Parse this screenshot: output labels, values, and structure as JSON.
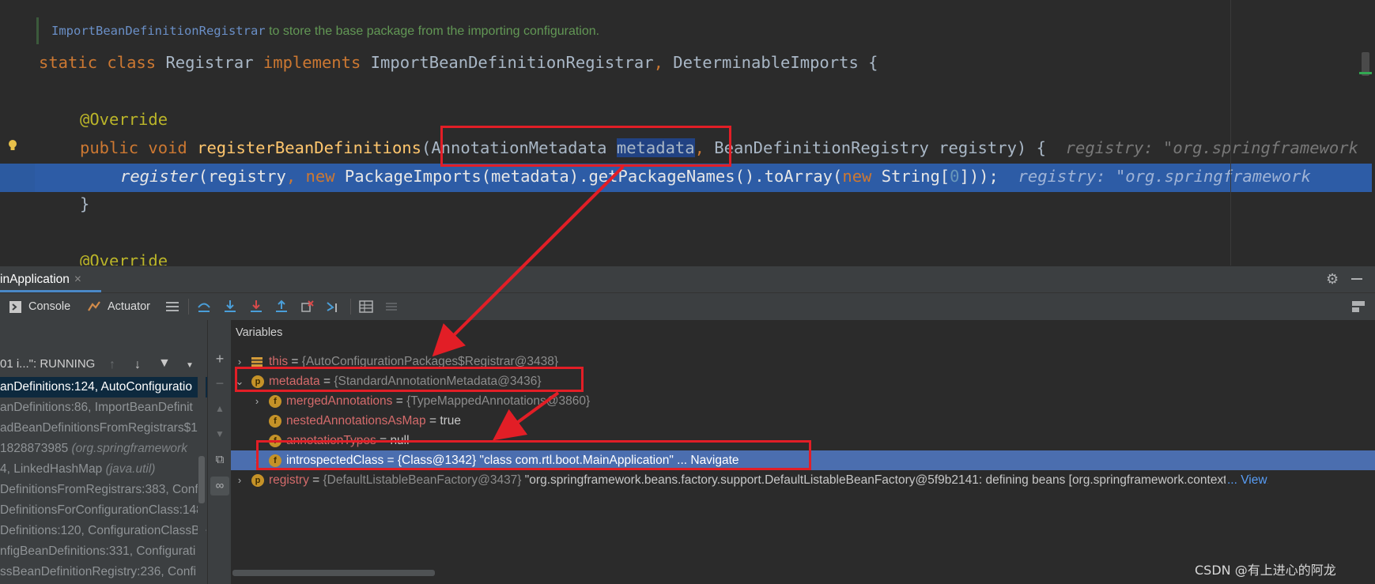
{
  "editor": {
    "doc_ref": "ImportBeanDefinitionRegistrar",
    "doc_text": " to store the base package from the importing configuration.",
    "line1": {
      "static": "static",
      "class": "class",
      "name": "Registrar",
      "implements": "implements",
      "iface1": "ImportBeanDefinitionRegistrar",
      "comma": ",",
      "iface2": "DeterminableImports",
      "brace": "{"
    },
    "line2": {
      "annotation": "@Override"
    },
    "line3": {
      "public": "public",
      "void": "void",
      "method": "registerBeanDefinitions",
      "open": "(",
      "type1": "AnnotationMetadata",
      "param1": "metadata",
      "comma": ",",
      "type2": "BeanDefinitionRegistry",
      "param2": "registry",
      "close": ") {",
      "hint": "registry: \"org.springframework"
    },
    "line4": {
      "call": "register",
      "p1": "(registry",
      "comma": ",",
      "new1": "new",
      "ctor": "PackageImports(metadata).getPackageNames().toArray(",
      "new2": "new",
      "str": "String[",
      "zero": "0",
      "end": "]));",
      "hint": "registry: \"org.springframework"
    },
    "line5": {
      "brace": "}"
    },
    "line6": {
      "annotation": "@Override"
    }
  },
  "debug": {
    "tab_label": "inApplication",
    "tab_close": "×",
    "toolbar": {
      "console": "Console",
      "actuator": "Actuator"
    },
    "thread": "01 i...\": RUNNING",
    "frames": [
      {
        "text": "anDefinitions:124, AutoConfiguratio",
        "lib": "",
        "selected": true
      },
      {
        "text": "anDefinitions:86, ImportBeanDefinit",
        "lib": "",
        "selected": false
      },
      {
        "text": "adBeanDefinitionsFromRegistrars$1",
        "lib": "",
        "selected": false
      },
      {
        "text": "1828873985 ",
        "lib": "(org.springframework",
        "selected": false
      },
      {
        "text": "4, LinkedHashMap ",
        "lib": "(java.util)",
        "selected": false
      },
      {
        "text": "DefinitionsFromRegistrars:383, Confi",
        "lib": "",
        "selected": false
      },
      {
        "text": "DefinitionsForConfigurationClass:148",
        "lib": "",
        "selected": false
      },
      {
        "text": "Definitions:120, ConfigurationClassBe",
        "lib": "",
        "selected": false
      },
      {
        "text": "nfigBeanDefinitions:331, Configurati",
        "lib": "",
        "selected": false
      },
      {
        "text": "ssBeanDefinitionRegistry:236, Confi",
        "lib": "",
        "selected": false
      }
    ],
    "variables_title": "Variables",
    "variables": [
      {
        "indent": 0,
        "chevron": "›",
        "icon": "stack",
        "name": "this",
        "eq": " = ",
        "value": "{AutoConfigurationPackages$Registrar@3438}",
        "extra": "",
        "link": "",
        "selected": false
      },
      {
        "indent": 0,
        "chevron": "⌄",
        "icon": "p",
        "name": "metadata",
        "eq": " = ",
        "value": "{StandardAnnotationMetadata@3436}",
        "extra": "",
        "link": "",
        "selected": false
      },
      {
        "indent": 1,
        "chevron": "›",
        "icon": "f",
        "name": "mergedAnnotations",
        "eq": " = ",
        "value": "{TypeMappedAnnotations@3860}",
        "extra": "",
        "link": "",
        "selected": false
      },
      {
        "indent": 1,
        "chevron": "",
        "icon": "f",
        "name": "nestedAnnotationsAsMap",
        "eq": " = ",
        "value": "true",
        "extra": "",
        "link": "",
        "selected": false
      },
      {
        "indent": 1,
        "chevron": "",
        "icon": "f",
        "name": "annotationTypes",
        "eq": " = ",
        "value": "null",
        "extra": "",
        "link": "",
        "selected": false
      },
      {
        "indent": 1,
        "chevron": "›",
        "icon": "f",
        "name": "introspectedClass",
        "eq": " = ",
        "value": "{Class@1342}",
        "extra": " \"class com.rtl.boot.MainApplication\" ... Navigate",
        "link": "",
        "selected": true
      },
      {
        "indent": 0,
        "chevron": "›",
        "icon": "p",
        "name": "registry",
        "eq": " = ",
        "value": "{DefaultListableBeanFactory@3437}",
        "extra": " \"org.springframework.beans.factory.support.DefaultListableBeanFactory@5f9b2141: defining beans [org.springframework.context.annota",
        "link": "... View",
        "selected": false
      }
    ]
  },
  "watermark": "CSDN @有上进心的阿龙",
  "colors": {
    "highlight_line": "#2d5ca6",
    "annotation_box": "#e21e26",
    "selected_row": "#4b6eaf"
  }
}
